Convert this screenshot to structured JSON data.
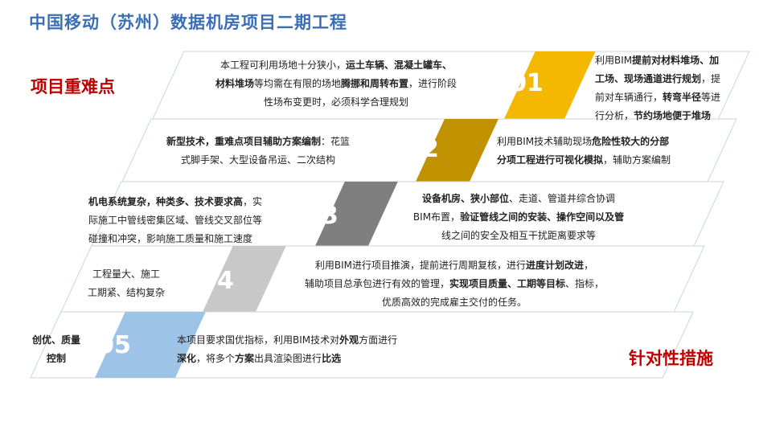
{
  "title": "中国移动（苏州）数据机房项目二期工程",
  "label_difficulties": "项目重难点",
  "label_measures": "针对性措施",
  "rows": [
    {
      "num": "01",
      "color": "#f5b800",
      "left_lines": [
        [
          {
            "t": "本工程可利用场地十分狭小，",
            "b": false
          },
          {
            "t": "运土车辆、混凝土罐车、",
            "b": true
          }
        ],
        [
          {
            "t": "材料堆场",
            "b": true
          },
          {
            "t": "等均需在有限的场地",
            "b": false
          },
          {
            "t": "腾挪和周转布置",
            "b": true
          },
          {
            "t": "，进行阶段",
            "b": false
          }
        ],
        [
          {
            "t": "性场布变更时，必须科学合理规划",
            "b": false
          }
        ]
      ],
      "right_lines": [
        [
          {
            "t": "利用BIM",
            "b": false
          },
          {
            "t": "提前对材料堆场、加",
            "b": true
          }
        ],
        [
          {
            "t": "工场、现场通道进行规划",
            "b": true
          },
          {
            "t": "，提",
            "b": false
          }
        ],
        [
          {
            "t": "前对车辆通行，",
            "b": false
          },
          {
            "t": "转弯半径",
            "b": true
          },
          {
            "t": "等进",
            "b": false
          }
        ],
        [
          {
            "t": "行分析，",
            "b": false
          },
          {
            "t": "节约场地便于堆场",
            "b": true
          }
        ]
      ]
    },
    {
      "num": "02",
      "color": "#c09100",
      "left_lines": [
        [
          {
            "t": "新型技术，重难点项目辅助方案编制",
            "b": true
          },
          {
            "t": "：花篮",
            "b": false
          }
        ],
        [
          {
            "t": "式脚手架、大型设备吊运、二次结构",
            "b": false
          }
        ]
      ],
      "right_lines": [
        [
          {
            "t": "利用BIM技术辅助现场",
            "b": false
          },
          {
            "t": "危险性较大的分部",
            "b": true
          }
        ],
        [
          {
            "t": "分项工程进行可视化模拟",
            "b": true
          },
          {
            "t": "，辅助方案编制",
            "b": false
          }
        ]
      ]
    },
    {
      "num": "03",
      "color": "#7f7f7f",
      "left_lines": [
        [
          {
            "t": "机电系统复杂，种类多、技术要求高",
            "b": true
          },
          {
            "t": "，实",
            "b": false
          }
        ],
        [
          {
            "t": "际施工中管线密集区域、管线交叉部位等",
            "b": false
          }
        ],
        [
          {
            "t": "碰撞和冲突，影响施工质量和施工速度",
            "b": false
          }
        ]
      ],
      "right_lines": [
        [
          {
            "t": "设备机房、狭小部位",
            "b": true
          },
          {
            "t": "、走道、管道井综合协调",
            "b": false
          }
        ],
        [
          {
            "t": "BIM布置，",
            "b": false
          },
          {
            "t": "验证管线之间的安装、操作空间以及管",
            "b": true
          }
        ],
        [
          {
            "t": "线之间的安全及相互干扰距离要求等",
            "b": false
          }
        ]
      ]
    },
    {
      "num": "04",
      "color": "#c8c8c8",
      "left_lines": [
        [
          {
            "t": "工程量大、施工",
            "b": false
          }
        ],
        [
          {
            "t": "工期紧、结构复杂",
            "b": false
          }
        ]
      ],
      "right_lines": [
        [
          {
            "t": "利用BIM进行项目推演，提前进行周期复核，进行",
            "b": false
          },
          {
            "t": "进度计划改进",
            "b": true
          },
          {
            "t": "，",
            "b": false
          }
        ],
        [
          {
            "t": "辅助项目总承包进行有效的管理，",
            "b": false
          },
          {
            "t": "实现项目质量、工期等目标",
            "b": true
          },
          {
            "t": "、指标，",
            "b": false
          }
        ],
        [
          {
            "t": "优质高效的完成雇主交付的任务。",
            "b": false
          }
        ]
      ]
    },
    {
      "num": "05",
      "color": "#9dc3e6",
      "left_lines": [
        [
          {
            "t": "创优、质量",
            "b": true
          }
        ],
        [
          {
            "t": "控制",
            "b": true
          }
        ]
      ],
      "right_lines": [
        [
          {
            "t": "本项目要求国优指标，利用BIM技术对",
            "b": false
          },
          {
            "t": "外观",
            "b": true
          },
          {
            "t": "方面进行",
            "b": false
          }
        ],
        [
          {
            "t": "深化",
            "b": true
          },
          {
            "t": "，将多个",
            "b": false
          },
          {
            "t": "方案",
            "b": true
          },
          {
            "t": "出具渲染图进行",
            "b": false
          },
          {
            "t": "比选",
            "b": true
          }
        ]
      ]
    }
  ]
}
